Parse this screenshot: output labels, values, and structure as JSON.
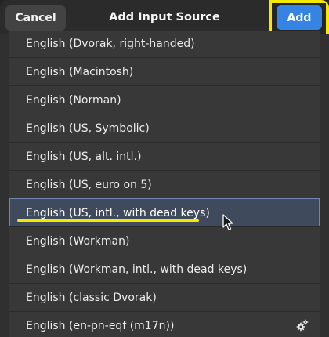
{
  "header": {
    "cancel_label": "Cancel",
    "title": "Add Input Source",
    "add_label": "Add"
  },
  "list": {
    "items": [
      {
        "label": "English (Dvorak, right-handed)"
      },
      {
        "label": "English (Macintosh)"
      },
      {
        "label": "English (Norman)"
      },
      {
        "label": "English (US, Symbolic)"
      },
      {
        "label": "English (US, alt. intl.)"
      },
      {
        "label": "English (US, euro on 5)"
      },
      {
        "label": "English (US, intl., with dead keys)",
        "selected": true
      },
      {
        "label": "English (Workman)"
      },
      {
        "label": "English (Workman, intl., with dead keys)"
      },
      {
        "label": "English (classic Dvorak)"
      },
      {
        "label": "English (en-pn-eqf (m17n))",
        "icon": "gear-icon"
      }
    ]
  },
  "colors": {
    "accent": "#3584e4",
    "highlight": "#f4ea00",
    "selection": "#3f4a5c"
  }
}
